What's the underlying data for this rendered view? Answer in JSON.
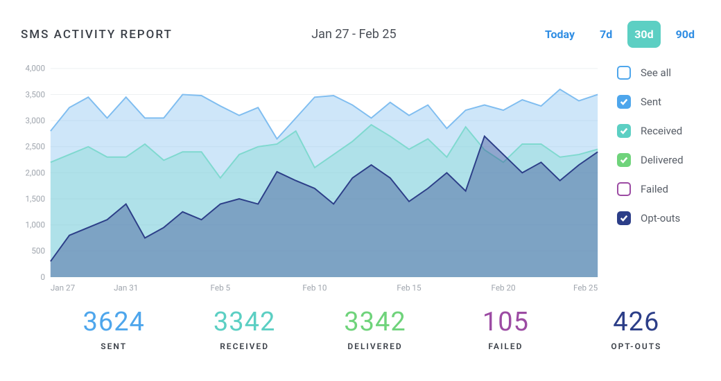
{
  "header": {
    "title": "SMS ACTIVITY REPORT",
    "date_range_label": "Jan 27 - Feb 25",
    "range_options": [
      "Today",
      "7d",
      "30d",
      "90d"
    ],
    "active_range": "30d"
  },
  "legend": [
    {
      "key": "all",
      "label": "See all",
      "color": "#4ea6ec",
      "checked": false,
      "outline": true
    },
    {
      "key": "sent",
      "label": "Sent",
      "color": "#4ea6ec",
      "checked": true,
      "outline": false
    },
    {
      "key": "received",
      "label": "Received",
      "color": "#5ccfc3",
      "checked": true,
      "outline": false
    },
    {
      "key": "delivered",
      "label": "Delivered",
      "color": "#6fd37b",
      "checked": true,
      "outline": false
    },
    {
      "key": "failed",
      "label": "Failed",
      "color": "#9c4ba3",
      "checked": false,
      "outline": true
    },
    {
      "key": "optouts",
      "label": "Opt-outs",
      "color": "#2c3e88",
      "checked": true,
      "outline": false
    }
  ],
  "stats": [
    {
      "key": "sent",
      "value": "3624",
      "label": "SENT",
      "color": "#4ea6ec"
    },
    {
      "key": "received",
      "value": "3342",
      "label": "RECEIVED",
      "color": "#5ccfc3"
    },
    {
      "key": "delivered",
      "value": "3342",
      "label": "DELIVERED",
      "color": "#6fd37b"
    },
    {
      "key": "failed",
      "value": "105",
      "label": "FAILED",
      "color": "#9c4ba3"
    },
    {
      "key": "optouts",
      "value": "426",
      "label": "OPT-OUTS",
      "color": "#2c3e88"
    }
  ],
  "chart_data": {
    "type": "area",
    "xlabel": "",
    "ylabel": "",
    "ylim": [
      0,
      4000
    ],
    "y_ticks": [
      0,
      500,
      1000,
      1500,
      2000,
      2500,
      3000,
      3500,
      4000
    ],
    "y_tick_labels": [
      "0",
      "500",
      "1,000",
      "1,500",
      "2,000",
      "2,500",
      "3,000",
      "3,500",
      "4,000"
    ],
    "x": [
      "Jan 27",
      "Jan 28",
      "Jan 29",
      "Jan 30",
      "Jan 31",
      "Feb 1",
      "Feb 2",
      "Feb 3",
      "Feb 4",
      "Feb 5",
      "Feb 6",
      "Feb 7",
      "Feb 8",
      "Feb 9",
      "Feb 10",
      "Feb 11",
      "Feb 12",
      "Feb 13",
      "Feb 14",
      "Feb 15",
      "Feb 16",
      "Feb 17",
      "Feb 18",
      "Feb 19",
      "Feb 20",
      "Feb 21",
      "Feb 22",
      "Feb 23",
      "Feb 24",
      "Feb 25"
    ],
    "x_tick_indices": [
      0,
      4,
      9,
      14,
      19,
      24,
      29
    ],
    "x_tick_labels": [
      "Jan 27",
      "Jan 31",
      "Feb 5",
      "Feb 10",
      "Feb 15",
      "Feb 20",
      "Feb 25"
    ],
    "series": [
      {
        "name": "Sent",
        "key": "sent",
        "color": "#7fbdf0",
        "line": "#7fbdf0",
        "values": [
          2800,
          3250,
          3450,
          3050,
          3450,
          3050,
          3050,
          3500,
          3480,
          3280,
          3100,
          3250,
          2650,
          3050,
          3450,
          3480,
          3300,
          3050,
          3350,
          3100,
          3300,
          2850,
          3200,
          3300,
          3200,
          3400,
          3280,
          3600,
          3380,
          3500
        ]
      },
      {
        "name": "Received",
        "key": "received",
        "color": "#7fd9cf",
        "line": "#7fd9cf",
        "values": [
          2200,
          2350,
          2500,
          2300,
          2300,
          2550,
          2240,
          2400,
          2400,
          1900,
          2350,
          2500,
          2550,
          2800,
          2100,
          2350,
          2600,
          2920,
          2700,
          2450,
          2650,
          2300,
          2880,
          2440,
          2200,
          2550,
          2550,
          2300,
          2350,
          2450
        ]
      },
      {
        "name": "Opt-outs",
        "key": "optouts",
        "color": "#2c3e88",
        "line": "#2c3e88",
        "values": [
          300,
          800,
          950,
          1100,
          1400,
          750,
          950,
          1250,
          1100,
          1400,
          1500,
          1400,
          2020,
          1850,
          1700,
          1400,
          1900,
          2150,
          1900,
          1450,
          1700,
          2000,
          1650,
          2700,
          2350,
          2000,
          2200,
          1850,
          2150,
          2400
        ]
      }
    ]
  }
}
